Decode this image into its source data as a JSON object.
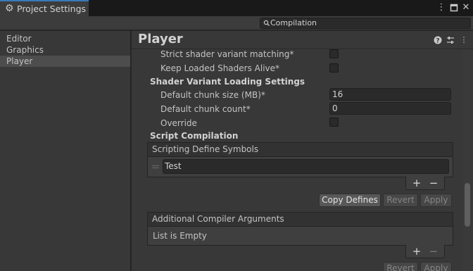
{
  "window": {
    "tab_title": "Project Settings",
    "icons": [
      "gear-icon",
      "kebab-menu-icon",
      "maximize-icon",
      "close-icon"
    ]
  },
  "search": {
    "value": "Compilation"
  },
  "sidebar": {
    "items": [
      {
        "label": "Editor",
        "selected": false
      },
      {
        "label": "Graphics",
        "selected": false
      },
      {
        "label": "Player",
        "selected": true
      }
    ]
  },
  "main": {
    "title": "Player",
    "header_icons": [
      "help-icon",
      "preset-icon",
      "more-icon"
    ],
    "strict_shader_label": "Strict shader variant matching*",
    "keep_loaded_label": "Keep Loaded Shaders Alive*",
    "shader_section": "Shader Variant Loading Settings",
    "chunk_size_label": "Default chunk size (MB)*",
    "chunk_size_value": "16",
    "chunk_count_label": "Default chunk count*",
    "chunk_count_value": "0",
    "override_label": "Override",
    "script_section": "Script Compilation",
    "define_symbols": {
      "header": "Scripting Define Symbols",
      "items": [
        "Test"
      ],
      "plus": "+",
      "minus": "−"
    },
    "buttons": {
      "copy": "Copy Defines",
      "revert": "Revert",
      "apply": "Apply"
    },
    "compiler_args": {
      "header": "Additional Compiler Arguments",
      "empty": "List is Empty",
      "plus": "+",
      "minus": "−"
    },
    "buttons2": {
      "revert": "Revert",
      "apply": "Apply"
    }
  },
  "colors": {
    "accent": "#3a79bb",
    "background": "#383838"
  }
}
